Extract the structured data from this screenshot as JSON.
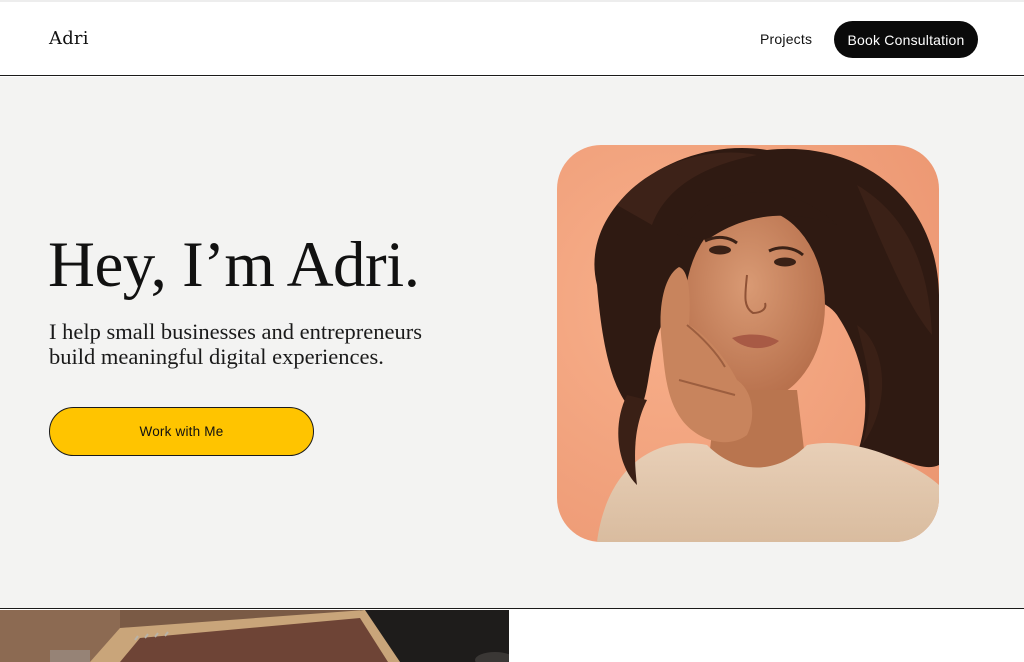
{
  "header": {
    "logo": "Adri",
    "nav": {
      "projects": "Projects",
      "book": "Book Consultation"
    }
  },
  "hero": {
    "title": "Hey, I’m Adri.",
    "subtitle_line1": "I help small businesses and entrepreneurs",
    "subtitle_line2": "build meaningful digital experiences.",
    "cta": "Work with Me"
  },
  "colors": {
    "hero_background": "#f3f3f2",
    "cta": "#ffc400",
    "book_button": "#0a0a0a",
    "portrait_backdrop": "#f6a57f"
  }
}
